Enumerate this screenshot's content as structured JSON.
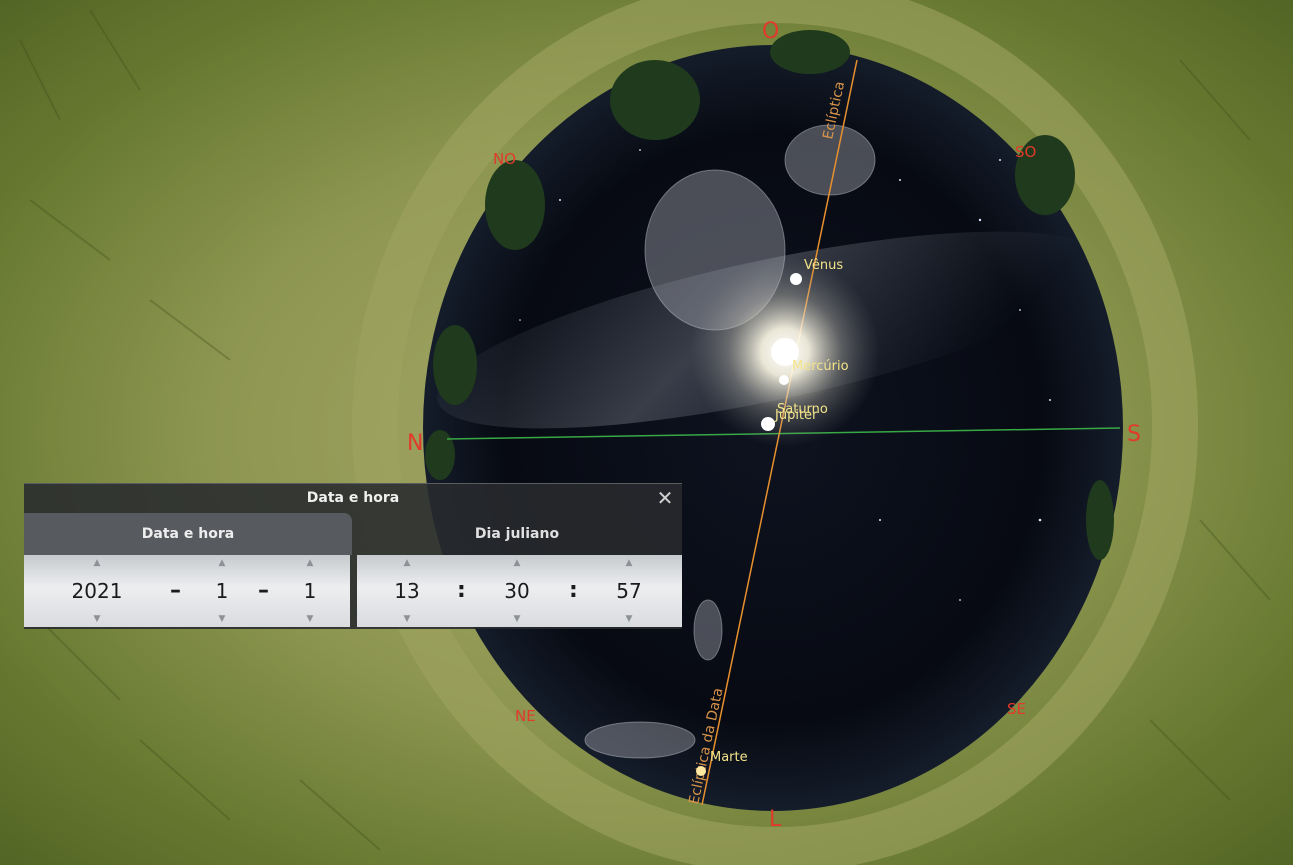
{
  "compass": {
    "north": "N",
    "south": "S",
    "east": "L",
    "west": "O",
    "northwest": "NO",
    "southwest": "SO",
    "northeast": "NE",
    "southeast": "SE"
  },
  "sky_labels": {
    "ecliptic": "Eclíptica",
    "ecliptic_of_date": "Eclíptica da Data",
    "venus": "Vênus",
    "mercury": "Mercúrio",
    "saturn": "Saturno",
    "jupiter": "Júpiter",
    "mars": "Marte"
  },
  "dialog": {
    "title": "Data e hora",
    "close_glyph": "✕",
    "tabs": [
      {
        "label": "Data e hora",
        "active": true
      },
      {
        "label": "Dia juliano",
        "active": false
      }
    ],
    "date": {
      "year": "2021",
      "month": "1",
      "day": "1",
      "separator": "–"
    },
    "time": {
      "hour": "13",
      "minute": "30",
      "second": "57",
      "separator": ":"
    },
    "spinner_up": "▲",
    "spinner_down": "▼"
  },
  "colors": {
    "compass": "#e23a2a",
    "planet_label": "#f3e48a",
    "ecliptic": "#e8902e",
    "horizon": "#38a845"
  }
}
